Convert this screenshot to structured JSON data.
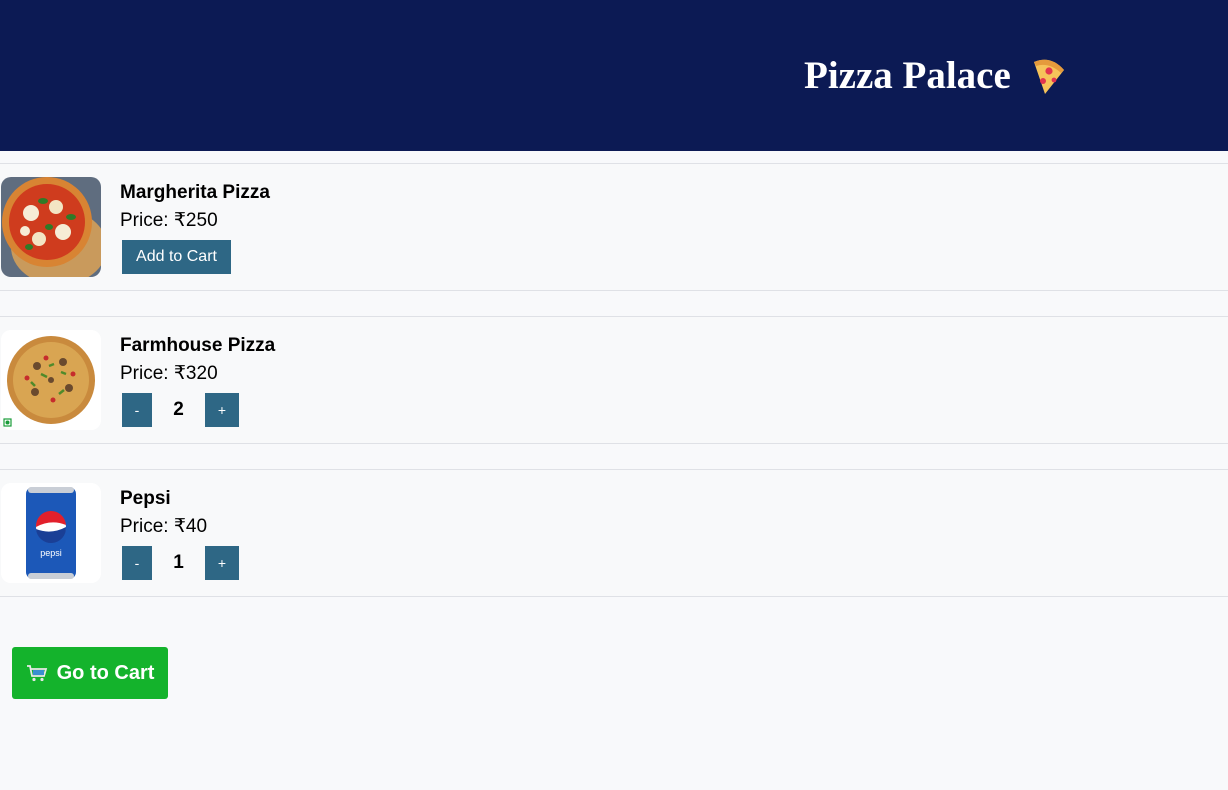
{
  "header": {
    "title": "Pizza Palace",
    "icon": "pizza-slice-icon",
    "background": "#0c1a54"
  },
  "items": [
    {
      "name": "Margherita Pizza",
      "price": "Price: ₹250",
      "image": "margherita-pizza-image",
      "add_label": "Add to Cart"
    },
    {
      "name": "Farmhouse Pizza",
      "price": "Price: ₹320",
      "image": "farmhouse-pizza-image",
      "minus_label": "-",
      "plus_label": "+",
      "quantity": "2"
    },
    {
      "name": "Pepsi",
      "price": "Price: ₹40",
      "image": "pepsi-can-image",
      "minus_label": "-",
      "plus_label": "+",
      "quantity": "1"
    }
  ],
  "cart_button": {
    "label": "Go to Cart",
    "icon": "shopping-cart-icon",
    "color": "#14b32c"
  },
  "colors": {
    "button": "#2e6785",
    "page_background": "#f8f9fb"
  }
}
